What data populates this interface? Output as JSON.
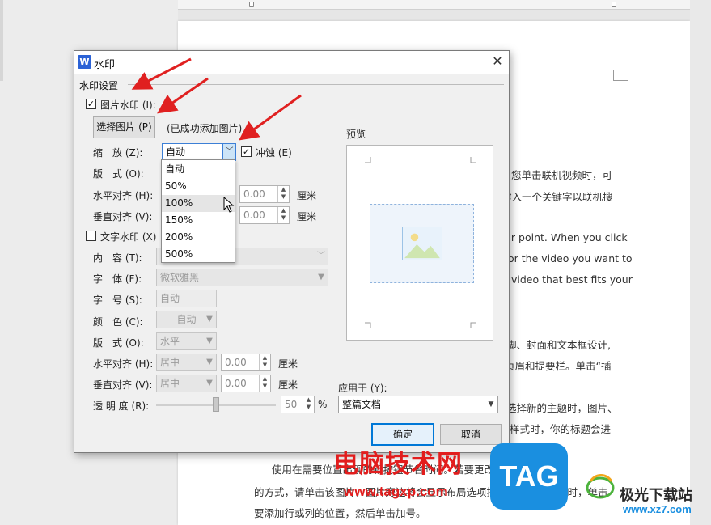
{
  "document": {
    "lines": [
      "您单击联机视频时，可",
      "键入一个关键字以联机搜",
      "ur point. When you click",
      "or the video you want to",
      "video that best fits your",
      "脚、封面和文本框设计,",
      "页眉和提要栏。单击“插",
      "选择新的主题时，图片、",
      "样式时，你的标题会进"
    ],
    "bottom_lines": [
      "使用在需要位置出现的新按钮节省时间。若要更改图片适应文档",
      "的方式，请单击该图片，图片旁边将会显示布局选项按钮。当处理表格时，单击",
      "要添加行或列的位置，然后单击加号。"
    ]
  },
  "dialog": {
    "title": "水印",
    "app_icon": "W",
    "close": "✕",
    "group": "水印设置",
    "picture_watermark": {
      "checked": true,
      "label": "图片水印 (I):",
      "select_button": "选择图片 (P)",
      "status": "(已成功添加图片)",
      "scale_label": "缩　放 (Z):",
      "scale_value": "自动",
      "washout_label": "冲蚀 (E)",
      "washout_checked": true,
      "scale_options": [
        "自动",
        "50%",
        "100%",
        "150%",
        "200%",
        "500%"
      ],
      "hovered_option": "100%",
      "layout_label": "版　式 (O):",
      "h_align_label": "水平对齐 (H):",
      "v_align_label": "垂直对齐 (V):",
      "h_value": "0.00",
      "v_value": "0.00",
      "unit": "厘米"
    },
    "text_watermark": {
      "checked": false,
      "label": "文字水印 (X)",
      "content_label": "内　容 (T):",
      "font_label": "字　体 (F):",
      "font_value": "微软雅黑",
      "size_label": "字　号 (S):",
      "size_value": "自动",
      "color_label": "颜　色 (C):",
      "color_value": "自动",
      "layout_label": "版　式 (O):",
      "layout_value": "水平",
      "h_align_label": "水平对齐 (H):",
      "h_align_value": "居中",
      "h_offset": "0.00",
      "v_align_label": "垂直对齐 (V):",
      "v_align_value": "居中",
      "v_offset": "0.00",
      "unit": "厘米",
      "transparency_label": "透 明 度 (R):",
      "transparency_value": "50",
      "percent": "%",
      "transparency_level": 50
    },
    "preview_label": "预览",
    "apply_label": "应用于 (Y):",
    "apply_value": "整篇文档",
    "ok": "确定",
    "cancel": "取消"
  },
  "overlays": {
    "site_name": "电脑技术网",
    "site_url": "www.tagxp.com",
    "tag_logo": "TAG",
    "brand2_name": "极光下载站",
    "brand2_url": "www.xz7.com"
  },
  "colors": {
    "accent": "#0078d7",
    "arrow": "#e02020",
    "watermark_red": "#e21d1d",
    "tag_blue": "#1a8fe0"
  }
}
